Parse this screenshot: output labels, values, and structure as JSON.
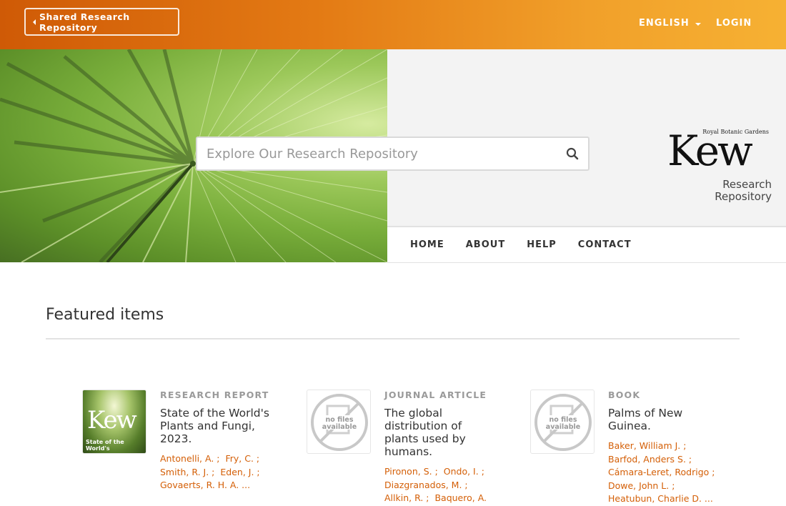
{
  "topbar": {
    "back_label": "Shared Research Repository",
    "language_label": "ENGLISH",
    "login_label": "LOGIN"
  },
  "header": {
    "search_placeholder": "Explore Our Research Repository",
    "logo_small": "Royal Botanic Gardens",
    "logo_main": "Kew",
    "repo_line1": "Research",
    "repo_line2": "Repository"
  },
  "nav": {
    "items": [
      "HOME",
      "ABOUT",
      "HELP",
      "CONTACT"
    ]
  },
  "featured": {
    "title": "Featured items",
    "items": [
      {
        "type": "RESEARCH REPORT",
        "title": "State of the World's Plants and Fungi, 2023.",
        "thumb_logo": "Kew",
        "thumb_caption": "State of the World's",
        "authors": [
          "Antonelli, A. ;",
          "Fry, C. ;",
          "Smith, R. J. ;",
          "Eden, J. ;",
          "Govaerts, R. H. A. ..."
        ]
      },
      {
        "type": "JOURNAL ARTICLE",
        "title": "The global distribution of plants used by humans.",
        "thumb_text": [
          "no files",
          "available"
        ],
        "authors": [
          "Pironon, S. ;",
          "Ondo, I. ;",
          "Diazgranados, M. ;",
          "Allkin, R. ;",
          "Baquero, A."
        ]
      },
      {
        "type": "BOOK",
        "title": "Palms of New Guinea.",
        "thumb_text": [
          "no files",
          "available"
        ],
        "authors": [
          "Baker, William J. ;",
          "Barfod, Anders S. ;",
          "Cámara-Leret, Rodrigo ;",
          "Dowe, John L. ;",
          "Heatubun, Charlie D. ..."
        ]
      }
    ]
  },
  "colors": {
    "accent": "#d45f07",
    "topbar_start": "#cf5a06",
    "topbar_end": "#f6b133"
  }
}
